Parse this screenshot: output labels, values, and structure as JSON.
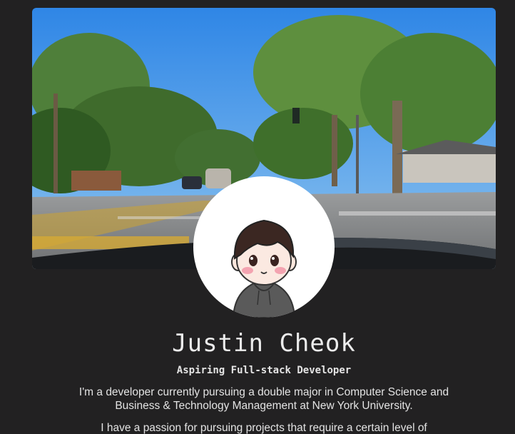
{
  "profile": {
    "name": "Justin Cheok",
    "tagline": "Aspiring Full-stack Developer",
    "bio": [
      "I'm a developer currently pursuing a double major in Computer Science and Business & Technology Management at New York University.",
      "I have a passion for pursuing projects that require a certain level of"
    ]
  },
  "colors": {
    "background": "#222122",
    "text": "#e9e9e9",
    "avatar_bg": "#ffffff"
  }
}
